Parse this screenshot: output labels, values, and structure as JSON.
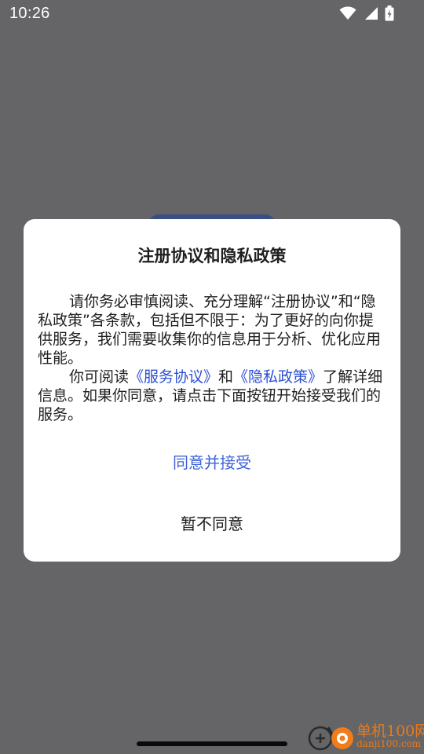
{
  "status_bar": {
    "time": "10:26",
    "icons": [
      "wifi-icon",
      "signal-icon",
      "battery-icon"
    ]
  },
  "dialog": {
    "title": "注册协议和隐私政策",
    "paragraph1": "请你务必审慎阅读、充分理解“注册协议”和“隐私政策”各条款，包括但不限于：为了更好的向你提供服务，我们需要收集你的信息用于分析、优化应用性能。",
    "paragraph2_prefix": "你可阅读",
    "service_link": "《服务协议》",
    "paragraph2_and": "和",
    "privacy_link": "《隐私政策》",
    "paragraph2_suffix": "了解详细信息。如果你同意，请点击下面按钮开始接受我们的服务。",
    "accept_label": "同意并接受",
    "decline_label": "暂不同意"
  },
  "watermark": {
    "text": "单机100网",
    "url": "danji100.com"
  },
  "colors": {
    "overlay": "#656567",
    "link": "#2b4fd3",
    "accept": "#3e63d8",
    "watermark": "#e87a1b"
  }
}
